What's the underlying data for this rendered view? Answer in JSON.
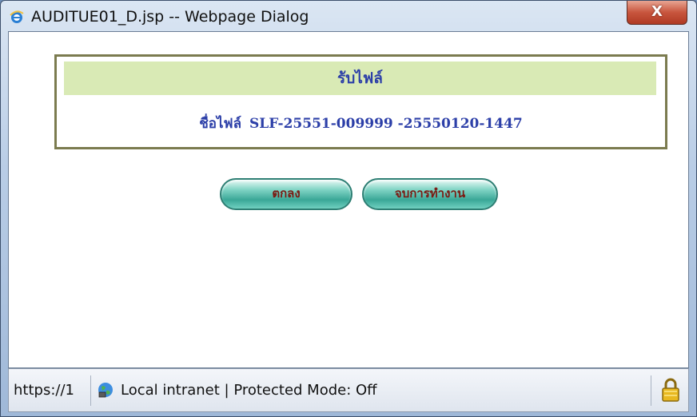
{
  "window": {
    "title": "AUDITUE01_D.jsp -- Webpage Dialog",
    "close_label": "X"
  },
  "panel": {
    "header": "รับไฟล์",
    "file_label": "ชื่อไฟล์",
    "file_name": "SLF-25551-009999 -25550120-1447"
  },
  "buttons": {
    "ok": "ตกลง",
    "exit": "จบการทำงาน"
  },
  "statusbar": {
    "url": "https://1",
    "zone": "Local intranet | Protected Mode: Off",
    "zone_icon": "globe-icon",
    "security_icon": "lock-icon"
  },
  "colors": {
    "header_bg": "#d9eab5",
    "text_blue": "#2c3fa8",
    "button_text": "#7b1a12",
    "button_teal": "#3aa797"
  }
}
